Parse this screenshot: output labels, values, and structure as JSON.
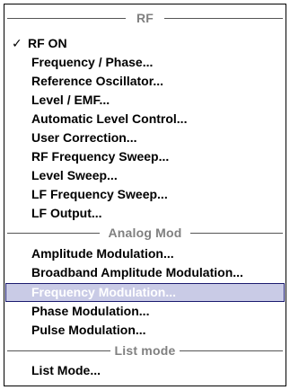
{
  "menu": {
    "groups": [
      {
        "title": "RF",
        "items": [
          {
            "label": "RF ON",
            "checked": true
          },
          {
            "label": "Frequency / Phase..."
          },
          {
            "label": "Reference Oscillator..."
          },
          {
            "label": "Level / EMF..."
          },
          {
            "label": "Automatic Level Control..."
          },
          {
            "label": "User Correction..."
          },
          {
            "label": "RF Frequency Sweep..."
          },
          {
            "label": "Level Sweep..."
          },
          {
            "label": "LF Frequency Sweep..."
          },
          {
            "label": "LF Output..."
          }
        ]
      },
      {
        "title": "Analog Mod",
        "items": [
          {
            "label": "Amplitude Modulation..."
          },
          {
            "label": "Broadband Amplitude Modulation..."
          },
          {
            "label": "Frequency Modulation...",
            "selected": true
          },
          {
            "label": "Phase Modulation..."
          },
          {
            "label": "Pulse Modulation..."
          }
        ]
      },
      {
        "title": "List mode",
        "items": [
          {
            "label": "List Mode..."
          }
        ]
      }
    ],
    "check_mark": "✓",
    "selected_color": "#c9cbe6"
  }
}
